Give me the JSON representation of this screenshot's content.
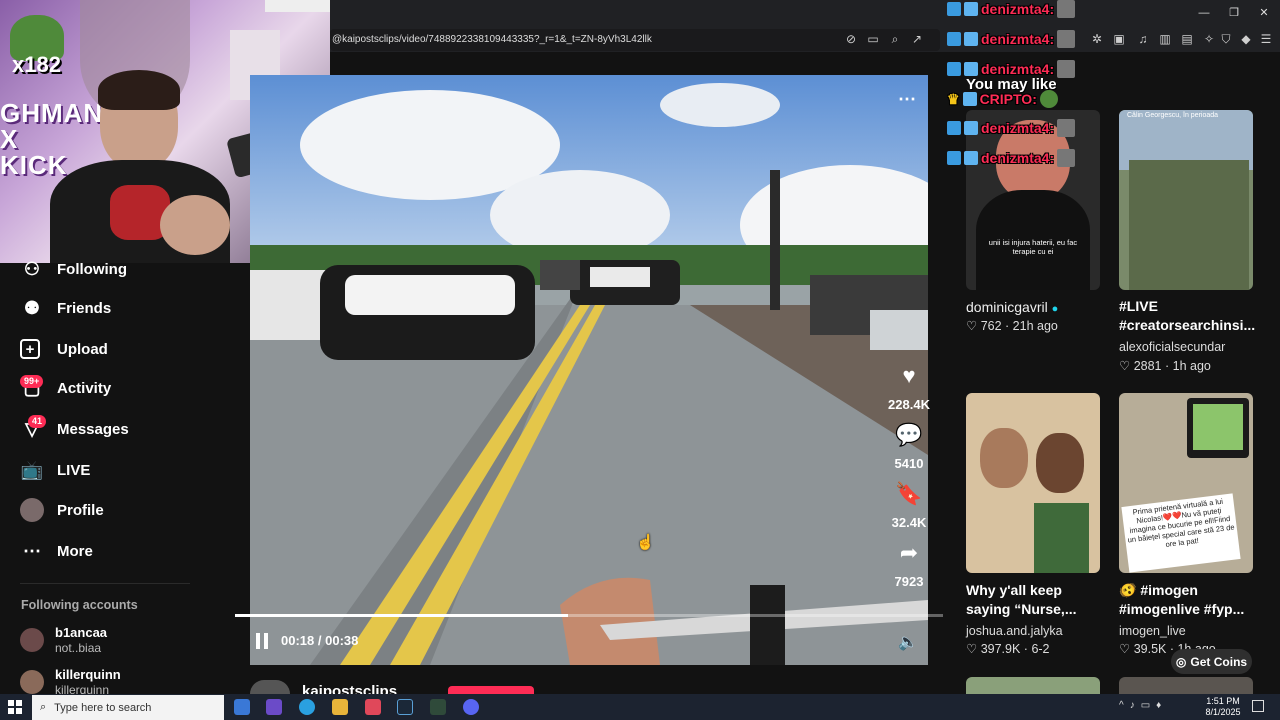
{
  "browser": {
    "url": "@kaipostsclips/video/7488922338109443335?_r=1&_t=ZN-8yVh3L42llk"
  },
  "webcam": {
    "viewer_count": "x182",
    "banner_text": "GHMAN X KICK"
  },
  "sidebar": {
    "items": [
      {
        "label": "Following",
        "icon": "following-icon"
      },
      {
        "label": "Friends",
        "icon": "friends-icon"
      },
      {
        "label": "Upload",
        "icon": "upload-icon"
      },
      {
        "label": "Activity",
        "icon": "activity-icon",
        "badge": "99+"
      },
      {
        "label": "Messages",
        "icon": "messages-icon",
        "badge": "41"
      },
      {
        "label": "LIVE",
        "icon": "live-icon"
      },
      {
        "label": "Profile",
        "icon": "profile-icon"
      },
      {
        "label": "More",
        "icon": "more-icon"
      }
    ],
    "following_header": "Following accounts",
    "accounts": [
      {
        "name": "b1ancaa",
        "handle": "not..biaa"
      },
      {
        "name": "killerquinn",
        "handle": "killerquinn"
      }
    ]
  },
  "video": {
    "time_current": "00:18",
    "time_sep": "/",
    "time_total": "00:38",
    "progress": 0.47,
    "author": "kaipostsclips",
    "likes": "228.4K",
    "comments": "5410",
    "saves": "32.4K",
    "shares": "7923"
  },
  "chat": {
    "user": "denizmta4:",
    "overlay_text": "You may like",
    "cripto": "CRIPTO:"
  },
  "recommended": [
    {
      "title": "",
      "thumb_caption": "unii isi injura haterii, eu fac terapie cu ei",
      "author": "dominicgavril",
      "likes": "762",
      "age": "21h ago",
      "verified": true
    },
    {
      "title": "#LIVE #creatorsearchinsi...",
      "thumb_caption": "Călin Georgescu, în perioada",
      "author": "alexoficialsecundar",
      "likes": "2881",
      "age": "1h ago"
    },
    {
      "title": "Why y'all keep saying “Nurse,...",
      "thumb_caption": "",
      "author": "joshua.and.jalyka",
      "likes": "397.9K",
      "age": "6-2"
    },
    {
      "title": "🫨 #imogen #imogenlive #fyp...",
      "thumb_caption": "Prima prietenă virtuală a lui Nicolas!❤️❤️Nu vă puteți imagina ce bucurie pe ell!Fiind un băiețel special care stă 23 de ore la pat!",
      "author": "imogen_live",
      "likes": "39.5K",
      "age": "1h ago"
    }
  ],
  "get_coins": "Get Coins",
  "taskbar": {
    "search_placeholder": "Type here to search",
    "time": "1:51 PM",
    "date": "8/1/2025"
  },
  "colors": {
    "accent": "#fe2c55",
    "background": "#121212",
    "taskbar": "#1c2330"
  }
}
